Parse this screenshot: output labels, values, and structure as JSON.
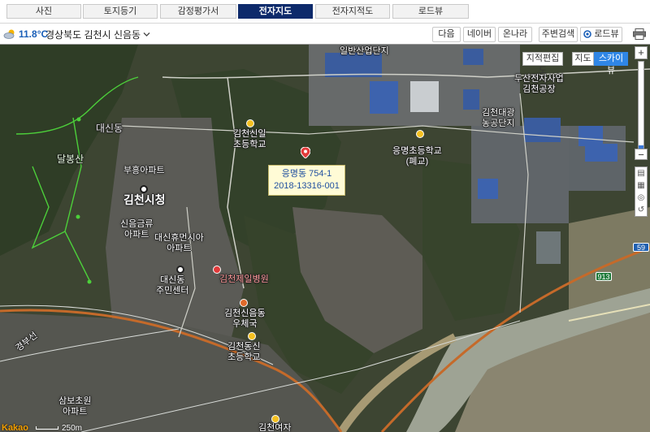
{
  "tabs": [
    {
      "label": "사진",
      "active": false
    },
    {
      "label": "토지등기",
      "active": false
    },
    {
      "label": "감정평가서",
      "active": false
    },
    {
      "label": "전자지도",
      "active": true
    },
    {
      "label": "전자지적도",
      "active": false
    },
    {
      "label": "로드뷰",
      "active": false
    }
  ],
  "toolbar": {
    "weather_icon": "cloudy-icon",
    "temperature": "11.8°C",
    "address": "경상북도 김천시 신음동",
    "next_label": "다음",
    "naver_label": "네이버",
    "onnara_label": "온나라",
    "nearby_label": "주변검색",
    "roadview_label": "로드뷰",
    "print_icon": "print-icon"
  },
  "map": {
    "cadastral_label": "지적편집도",
    "map_label": "지도",
    "skyview_label": "스카이뷰",
    "zoom_in": "+",
    "zoom_out": "−",
    "zoom_level": 0.05,
    "scale_label": "250m",
    "provider": "Kakao",
    "callout": {
      "line1": "응명동 754-1",
      "line2": "2018-13316-001"
    },
    "labels": {
      "industrial": "일반산업단지",
      "doosan": "두산전자사업\n김천공장",
      "industrial2": "김천대광\n농공단지",
      "sinil_school": "김천신일\n초등학교",
      "eungmyeong_school": "응명초등학교\n(폐교)",
      "daesin": "대신동",
      "dalbong": "달봉산",
      "buheung": "부흥아파트",
      "city_hall": "김천시청",
      "singeum": "신음금류\n아파트",
      "daesin_apt": "대신휴먼시아\n아파트",
      "community": "대신동\n주민센터",
      "hospital": "김천제일병원",
      "post": "김천신음동\n우체국",
      "dongsin_school": "김천동신\n초등학교",
      "sambo": "삼보초원\n아파트",
      "women": "김천여자",
      "station_line": "경부선",
      "road913": "913",
      "road59": "59"
    }
  }
}
